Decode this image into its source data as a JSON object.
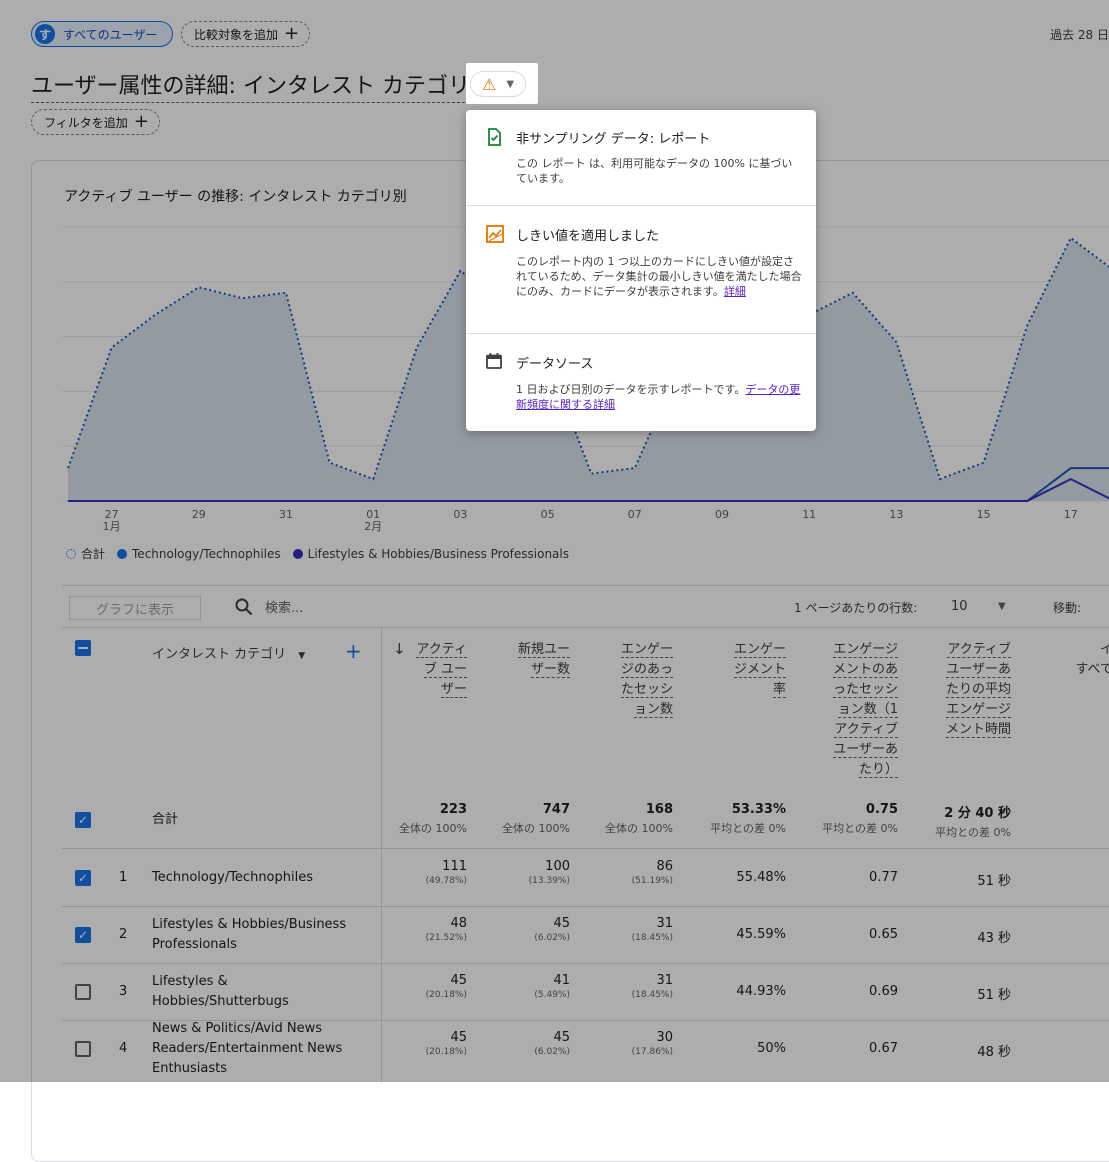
{
  "header": {
    "segment_avatar": "す",
    "segment_label": "すべてのユーザー",
    "add_comparison": "比較対象を追加",
    "date_range": "過去 28 日",
    "page_title": "ユーザー属性の詳細: インタレスト カテゴリ",
    "add_filter": "フィルタを追加"
  },
  "chart": {
    "title": "アクティブ ユーザー の推移: インタレスト カテゴリ別",
    "legend": [
      {
        "label": "合計",
        "color": "#1a73e8"
      },
      {
        "label": "Technology/Technophiles",
        "color": "#1a73e8"
      },
      {
        "label": "Lifestyles & Hobbies/Business Professionals",
        "color": "#3b2ec0"
      }
    ]
  },
  "chart_data": {
    "type": "line",
    "title": "アクティブ ユーザー の推移: インタレスト カテゴリ別",
    "x_ticks": [
      "27 1月",
      "29",
      "31",
      "01 2月",
      "03",
      "05",
      "07",
      "09",
      "11",
      "13",
      "15",
      "17"
    ],
    "series": [
      {
        "name": "合計",
        "style": "dotted-area",
        "values": [
          3,
          14,
          17,
          19.5,
          18.5,
          19,
          3.5,
          2,
          14,
          21,
          18,
          13,
          2.5,
          3,
          12,
          19,
          19,
          17,
          19,
          14.5,
          2,
          3.5,
          16,
          24,
          21
        ]
      },
      {
        "name": "Technology/Technophiles",
        "values": [
          0,
          0,
          0,
          0,
          0,
          0,
          0,
          0,
          0,
          0,
          0,
          0,
          0,
          0,
          0,
          0,
          0,
          0,
          0,
          0,
          0,
          0,
          0,
          3,
          3
        ]
      },
      {
        "name": "Lifestyles & Hobbies/Business Professionals",
        "values": [
          0,
          0,
          0,
          0,
          0,
          0,
          0,
          0,
          0,
          0,
          0,
          0,
          0,
          0,
          0,
          0,
          0,
          0,
          0,
          0,
          0,
          0,
          0,
          2,
          0
        ]
      }
    ]
  },
  "toolbar": {
    "show_in_chart": "グラフに表示",
    "search_placeholder": "検索...",
    "rows_per_page_label": "1 ページあたりの行数:",
    "rows_per_page": "10",
    "goto": "移動:"
  },
  "table": {
    "dimension_header": "インタレスト カテゴリ",
    "columns": [
      [
        "アクティ",
        "ブ ユー",
        "ザー"
      ],
      [
        "新規ユー",
        "ザー数"
      ],
      [
        "エンゲー",
        "ジのあっ",
        "たセッシ",
        "ョン数"
      ],
      [
        "エンゲー",
        "ジメント",
        "率"
      ],
      [
        "エンゲージ",
        "メントのあ",
        "ったセッシ",
        "ョン数（1",
        "アクティブ",
        "ユーザーあ",
        "たり）"
      ],
      [
        "アクティブ",
        "ユーザーあ",
        "たりの平均",
        "エンゲージ",
        "メント時間"
      ]
    ],
    "extra_col_fragment": [
      "イ",
      "すべて"
    ],
    "total": {
      "label": "合計",
      "values": [
        "223",
        "747",
        "168",
        "53.33%",
        "0.75",
        "2 分 40 秒"
      ],
      "subs": [
        "全体の 100%",
        "全体の 100%",
        "全体の 100%",
        "平均との差 0%",
        "平均との差 0%",
        "平均との差 0%"
      ]
    },
    "rows": [
      {
        "idx": "1",
        "lines": [
          "Technology/Technophiles"
        ],
        "checked": true,
        "values": [
          "111",
          "100",
          "86",
          "55.48%",
          "0.77",
          "51 秒"
        ],
        "subs": [
          "(49.78%)",
          "(13.39%)",
          "(51.19%)",
          "",
          "",
          ""
        ]
      },
      {
        "idx": "2",
        "lines": [
          "Lifestyles & Hobbies/Business",
          "Professionals"
        ],
        "checked": true,
        "values": [
          "48",
          "45",
          "31",
          "45.59%",
          "0.65",
          "43 秒"
        ],
        "subs": [
          "(21.52%)",
          "(6.02%)",
          "(18.45%)",
          "",
          "",
          ""
        ]
      },
      {
        "idx": "3",
        "lines": [
          "Lifestyles &",
          "Hobbies/Shutterbugs"
        ],
        "checked": false,
        "values": [
          "45",
          "41",
          "31",
          "44.93%",
          "0.69",
          "51 秒"
        ],
        "subs": [
          "(20.18%)",
          "(5.49%)",
          "(18.45%)",
          "",
          "",
          ""
        ]
      },
      {
        "idx": "4",
        "lines": [
          "News & Politics/Avid News",
          "Readers/Entertainment News",
          "Enthusiasts"
        ],
        "checked": false,
        "values": [
          "45",
          "45",
          "30",
          "50%",
          "0.67",
          "48 秒"
        ],
        "subs": [
          "(20.18%)",
          "(6.02%)",
          "(17.86%)",
          "",
          "",
          ""
        ]
      }
    ]
  },
  "popup": {
    "sections": [
      {
        "icon": "verified-icon",
        "title": "非サンプリング データ: レポート",
        "body": "この レポート は、利用可能なデータの 100% に基づいています。",
        "link": ""
      },
      {
        "icon": "threshold-chart-icon",
        "title": "しきい値を適用しました",
        "body": "このレポート内の 1 つ以上のカードにしきい値が設定されているため、データ集計の最小しきい値を満たした場合にのみ、カードにデータが表示されます。",
        "link": "詳細"
      },
      {
        "icon": "calendar-icon",
        "title": "データソース",
        "body": "1 日および日別のデータを示すレポートです。",
        "link": "データの更新頻度に関する詳細"
      }
    ]
  },
  "colors": {
    "accent": "#1a73e8",
    "warning": "#e37400",
    "link": "#5a23c8"
  }
}
